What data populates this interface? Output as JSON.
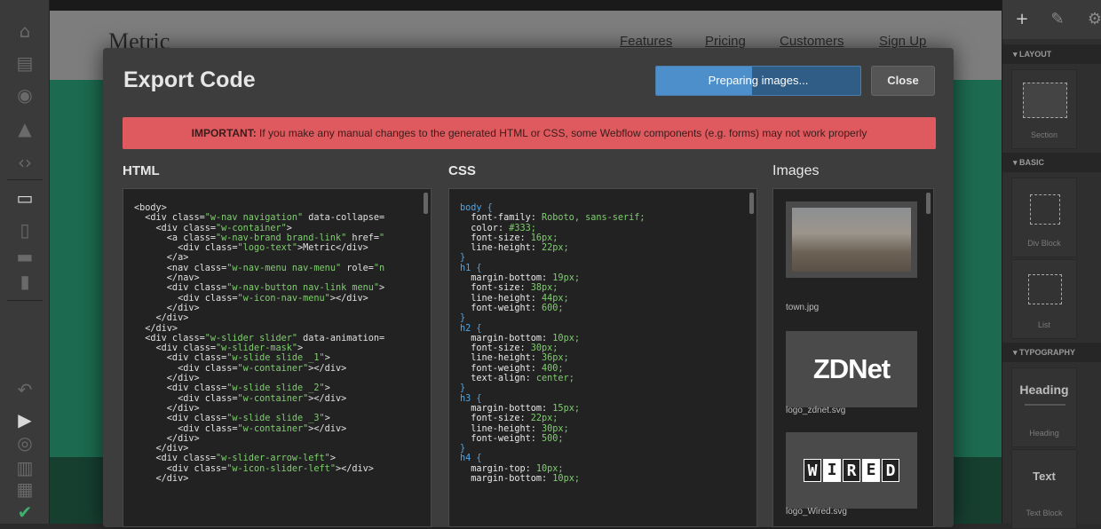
{
  "canvas": {
    "site_logo": "Metric",
    "nav": [
      "Features",
      "Pricing",
      "Customers",
      "Sign Up"
    ]
  },
  "modal": {
    "title": "Export Code",
    "progress_text": "Preparing images...",
    "progress_fraction": 0.47,
    "close_label": "Close",
    "warning_strong": "IMPORTANT:",
    "warning_text": " If you make any manual changes to the generated HTML or CSS, some Webflow components (e.g. forms) may not work properly",
    "html_heading": "HTML",
    "css_heading": "CSS",
    "images_heading": "Images",
    "html_lines": [
      "<body>",
      "  <div class=\"w-nav navigation\" data-collapse=",
      "    <div class=\"w-container\">",
      "      <a class=\"w-nav-brand brand-link\" href=\"",
      "        <div class=\"logo-text\">Metric</div>",
      "      </a>",
      "      <nav class=\"w-nav-menu nav-menu\" role=\"n",
      "      </nav>",
      "      <div class=\"w-nav-button nav-link menu\">",
      "        <div class=\"w-icon-nav-menu\"></div>",
      "      </div>",
      "    </div>",
      "  </div>",
      "  <div class=\"w-slider slider\" data-animation=",
      "    <div class=\"w-slider-mask\">",
      "      <div class=\"w-slide slide _1\">",
      "        <div class=\"w-container\"></div>",
      "      </div>",
      "      <div class=\"w-slide slide _2\">",
      "        <div class=\"w-container\"></div>",
      "      </div>",
      "      <div class=\"w-slide slide _3\">",
      "        <div class=\"w-container\"></div>",
      "      </div>",
      "    </div>",
      "    <div class=\"w-slider-arrow-left\">",
      "      <div class=\"w-icon-slider-left\"></div>",
      "    </div>"
    ],
    "css_lines": [
      [
        "body {",
        "",
        ""
      ],
      [
        "  font-family",
        ": ",
        "Roboto, sans-serif;"
      ],
      [
        "  color",
        ": ",
        "#333;"
      ],
      [
        "  font-size",
        ": ",
        "16px;"
      ],
      [
        "  line-height",
        ": ",
        "22px;"
      ],
      [
        "}",
        "",
        ""
      ],
      [
        "h1 {",
        "",
        ""
      ],
      [
        "  margin-bottom",
        ": ",
        "19px;"
      ],
      [
        "  font-size",
        ": ",
        "38px;"
      ],
      [
        "  line-height",
        ": ",
        "44px;"
      ],
      [
        "  font-weight",
        ": ",
        "600;"
      ],
      [
        "}",
        "",
        ""
      ],
      [
        "h2 {",
        "",
        ""
      ],
      [
        "  margin-bottom",
        ": ",
        "10px;"
      ],
      [
        "  font-size",
        ": ",
        "30px;"
      ],
      [
        "  line-height",
        ": ",
        "36px;"
      ],
      [
        "  font-weight",
        ": ",
        "400;"
      ],
      [
        "  text-align",
        ": ",
        "center;"
      ],
      [
        "}",
        "",
        ""
      ],
      [
        "h3 {",
        "",
        ""
      ],
      [
        "  margin-bottom",
        ": ",
        "15px;"
      ],
      [
        "  font-size",
        ": ",
        "22px;"
      ],
      [
        "  line-height",
        ": ",
        "30px;"
      ],
      [
        "  font-weight",
        ": ",
        "500;"
      ],
      [
        "}",
        "",
        ""
      ],
      [
        "h4 {",
        "",
        ""
      ],
      [
        "  margin-top",
        ": ",
        "10px;"
      ],
      [
        "  margin-bottom",
        ": ",
        "10px;"
      ]
    ],
    "images": [
      {
        "caption": "town.jpg",
        "kind": "photo"
      },
      {
        "caption": "logo_zdnet.svg",
        "kind": "zdnet",
        "logo_text": "ZDNet"
      },
      {
        "caption": "logo_Wired.svg",
        "kind": "wired",
        "logo_text": "WIRED"
      }
    ]
  },
  "right_panel": {
    "sections": [
      "LAYOUT",
      "BASIC",
      "TYPOGRAPHY"
    ],
    "items": [
      {
        "label": "Section"
      },
      {
        "label": "Div Block"
      },
      {
        "label": "List"
      },
      {
        "label": "Heading",
        "big": "Heading"
      },
      {
        "label": "Text Block",
        "big": "Text"
      }
    ],
    "colors": {
      "bg": "#2f2f2f",
      "accent": "#4d8fca",
      "warning": "#df5a5e",
      "green": "#1c6a4f"
    }
  }
}
